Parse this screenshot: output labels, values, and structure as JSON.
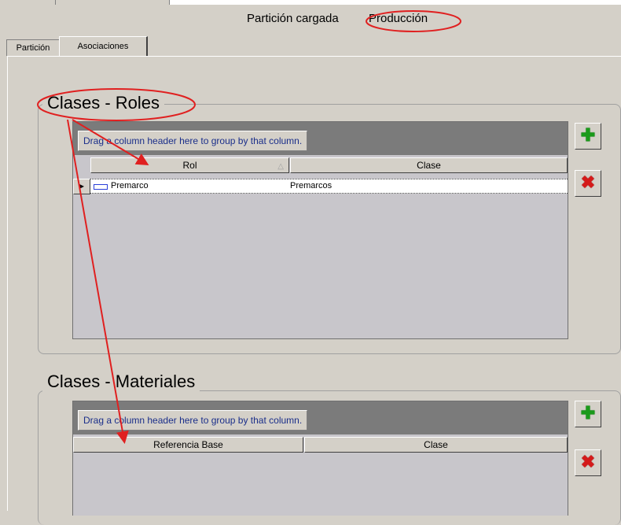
{
  "header": {
    "loaded_label": "Partición cargada",
    "loaded_value": "Producción"
  },
  "tabs": [
    {
      "label": "Partición",
      "active": false
    },
    {
      "label": "Asociaciones",
      "active": true
    }
  ],
  "roles_section": {
    "title": "Clases - Roles",
    "group_hint": "Drag a column header here to group by that column.",
    "columns": [
      "Rol",
      "Clase"
    ],
    "rows": [
      {
        "rol": "Premarco",
        "clase": "Premarcos"
      }
    ]
  },
  "materials_section": {
    "title": "Clases - Materiales",
    "group_hint": "Drag a column header here to group by that column.",
    "columns": [
      "Referencia Base",
      "Clase"
    ],
    "rows": []
  },
  "icons": {
    "add": "plus-icon",
    "delete": "cross-icon",
    "sort": "sort-ascending-icon",
    "row_indicator": "row-pointer-icon"
  },
  "colors": {
    "annotation": "#e02020",
    "add_icon": "#1a9a1a",
    "delete_icon": "#d41a1a",
    "group_hint_text": "#1a2e8a"
  }
}
